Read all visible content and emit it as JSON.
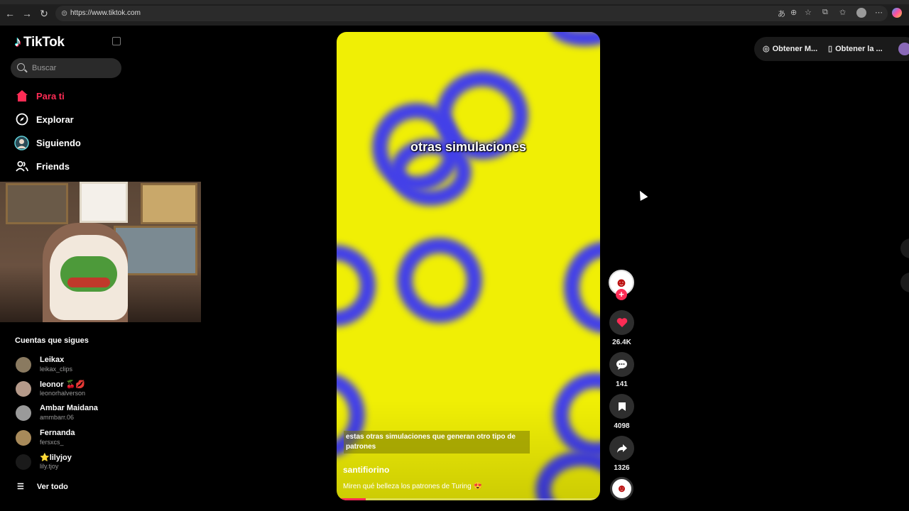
{
  "browser": {
    "url": "https://www.tiktok.com"
  },
  "sidebar": {
    "brand": "TikTok",
    "search_placeholder": "Buscar",
    "nav": [
      {
        "label": "Para ti",
        "icon": "home-icon",
        "active": true
      },
      {
        "label": "Explorar",
        "icon": "compass-icon"
      },
      {
        "label": "Siguiendo",
        "icon": "following-avatar-icon"
      },
      {
        "label": "Friends",
        "icon": "friends-icon"
      }
    ],
    "following_title": "Cuentas que sigues",
    "accounts": [
      {
        "name": "Leikax",
        "handle": "leikax_clips"
      },
      {
        "name": "leonor 🍒💋",
        "handle": "leonorhalverson"
      },
      {
        "name": "Ambar Maidana",
        "handle": "ammbarr.06"
      },
      {
        "name": "Fernanda",
        "handle": "fersxcs_"
      },
      {
        "name": "⭐lilyjoy",
        "handle": "lily.tjoy"
      }
    ],
    "see_all": "Ver todo"
  },
  "video": {
    "overlay_text": "otras simulaciones",
    "subtitle": "estas otras simulaciones que generan otro tipo de patrones",
    "author": "santifiorino",
    "description": "Miren qué belleza los patrones de Turing 😍",
    "progress": 0.11,
    "background_color": "#f0ef05",
    "pattern_color": "#4340e8"
  },
  "actions": {
    "likes": "26.4K",
    "comments": "141",
    "saves": "4098",
    "shares": "1326"
  },
  "topright": {
    "pill1": "Obtener M...",
    "pill2": "Obtener la ..."
  },
  "colors": {
    "accent": "#fe2c55"
  }
}
